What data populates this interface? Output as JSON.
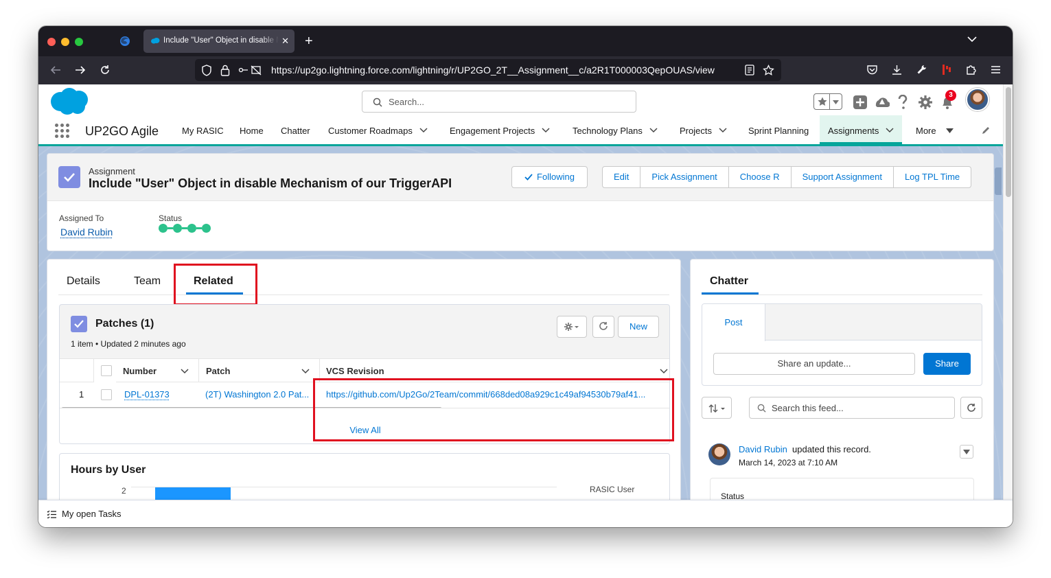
{
  "browser": {
    "tab_title": "Include \"User\" Object in disable Mechanism of our TriggerAPI",
    "url": "https://up2go.lightning.force.com/lightning/r/UP2GO_2T__Assignment__c/a2R1T000003QepOUAS/view"
  },
  "header": {
    "search_placeholder": "Search...",
    "notification_count": "3"
  },
  "app_nav": {
    "app_name": "UP2GO Agile",
    "items": [
      {
        "label": "My RASIC"
      },
      {
        "label": "Home"
      },
      {
        "label": "Chatter"
      },
      {
        "label": "Customer Roadmaps"
      },
      {
        "label": "Engagement Projects"
      },
      {
        "label": "Technology Plans"
      },
      {
        "label": "Projects"
      },
      {
        "label": "Sprint Planning"
      },
      {
        "label": "Assignments"
      },
      {
        "label": "More"
      }
    ]
  },
  "record": {
    "object_label": "Assignment",
    "title": "Include \"User\" Object in disable Mechanism of our TriggerAPI",
    "following_label": "Following",
    "actions": [
      "Edit",
      "Pick Assignment",
      "Choose R",
      "Support Assignment",
      "Log TPL Time"
    ],
    "fields": {
      "assigned_to_label": "Assigned To",
      "assigned_to_value": "David Rubin",
      "status_label": "Status"
    }
  },
  "main_tabs": [
    {
      "label": "Details"
    },
    {
      "label": "Team"
    },
    {
      "label": "Related",
      "active": true
    }
  ],
  "patches": {
    "title": "Patches (1)",
    "subtitle": "1 item • Updated 2 minutes ago",
    "new_label": "New",
    "columns": [
      "Number",
      "Patch",
      "VCS Revision"
    ],
    "rows": [
      {
        "index": "1",
        "number": "DPL-01373",
        "patch": "(2T) Washington 2.0 Pat...",
        "vcs_revision": "https://github.com/Up2Go/2Team/commit/668ded08a929c1c49af94530b79af41..."
      }
    ],
    "view_all": "View All"
  },
  "hours_by_user": {
    "title": "Hours by User",
    "tick_label": "2",
    "legend_title": "RASIC User"
  },
  "chatter": {
    "title": "Chatter",
    "post_tab": "Post",
    "share_placeholder": "Share an update...",
    "share_button": "Share",
    "feed_search_placeholder": "Search this feed...",
    "post": {
      "author": "David Rubin",
      "action": "updated this record.",
      "time": "March 14, 2023 at 7:10 AM",
      "field_label": "Status"
    }
  },
  "utility_bar": {
    "label": "My open Tasks"
  },
  "colors": {
    "brand_blue": "#0176d3",
    "nav_accent": "#06a59a",
    "highlight_red": "#e0101f",
    "status_green": "#2cc28c"
  }
}
